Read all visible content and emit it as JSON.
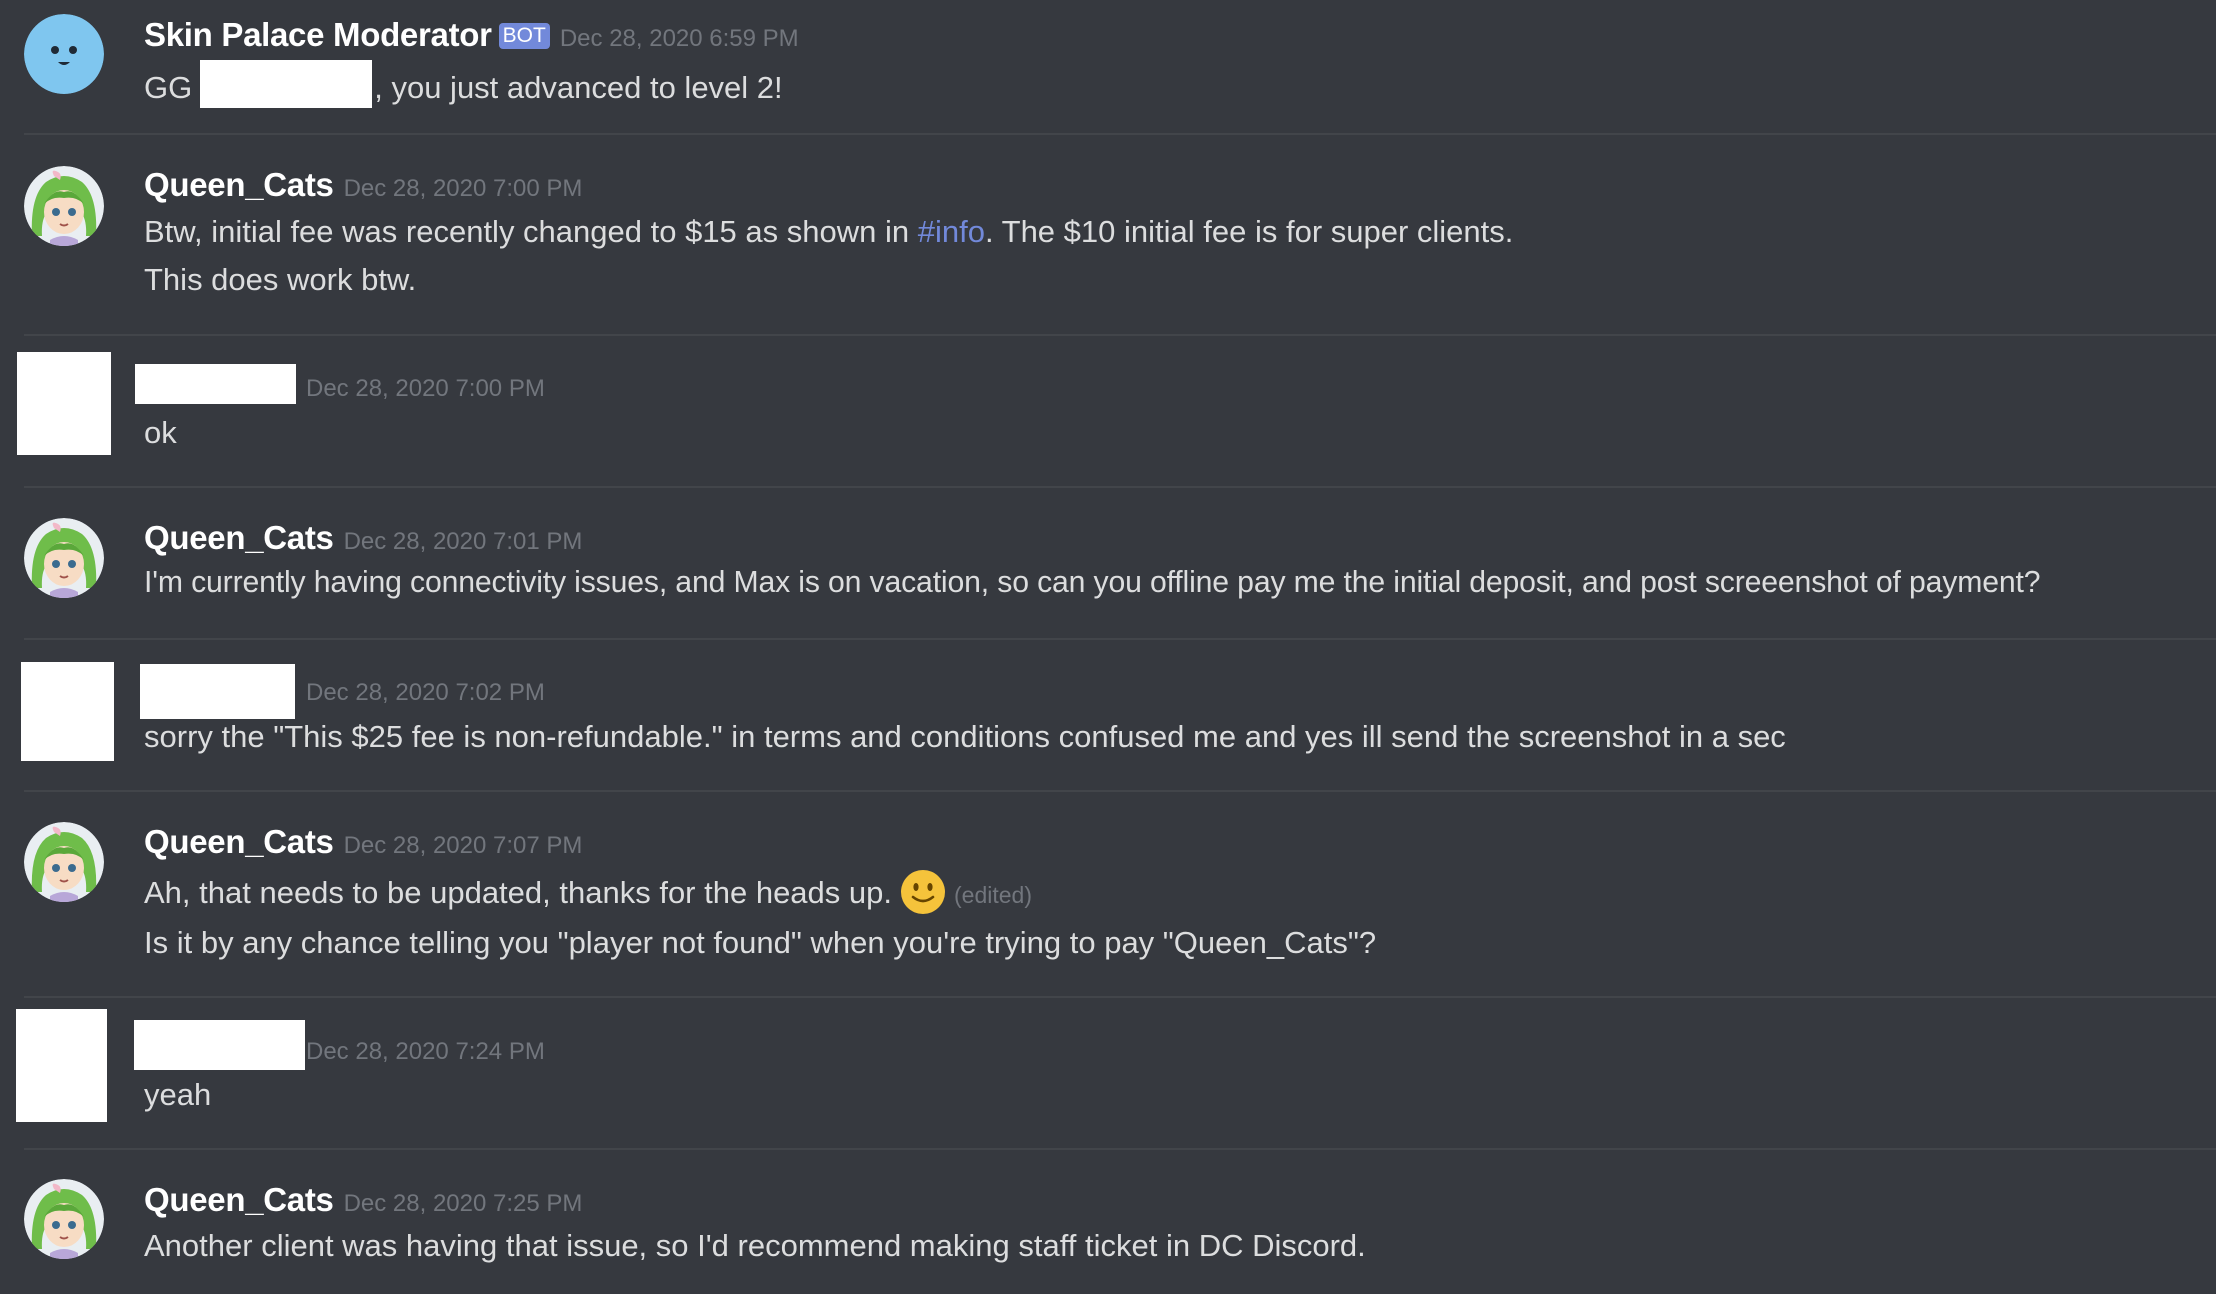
{
  "messages": [
    {
      "username": "Skin Palace Moderator",
      "badge": "BOT",
      "timestamp": "Dec 28, 2020 6:59 PM",
      "line1_prefix": "GG",
      "line1_suffix": ", you just advanced to level 2!"
    },
    {
      "username": "Queen_Cats",
      "timestamp": "Dec 28, 2020 7:00 PM",
      "line1_before": "Btw, initial fee was recently changed to $15 as shown in ",
      "channel_mention": "#info",
      "line1_after": ". The $10 initial fee is for super clients.",
      "line2": "This does work btw."
    },
    {
      "username": "",
      "timestamp": "Dec 28, 2020 7:00 PM",
      "line1": "ok"
    },
    {
      "username": "Queen_Cats",
      "timestamp": "Dec 28, 2020 7:01 PM",
      "line1": "I'm currently having connectivity issues, and Max is on vacation, so can you offline pay me the initial deposit, and post screeenshot of payment?"
    },
    {
      "username": "",
      "timestamp": "Dec 28, 2020 7:02 PM",
      "line1": "sorry the \"This $25 fee is non-refundable.\" in terms and conditions confused me and yes ill send the screenshot in a sec"
    },
    {
      "username": "Queen_Cats",
      "timestamp": "Dec 28, 2020 7:07 PM",
      "line1": "Ah, that needs to be updated, thanks for the heads up.",
      "emoji": "slightly-smiling-face-emoji",
      "edited": "(edited)",
      "line2": "Is it by any chance telling you \"player not found\" when you're trying to pay \"Queen_Cats\"?"
    },
    {
      "username": "",
      "timestamp": "Dec 28, 2020 7:24 PM",
      "line1": "yeah"
    },
    {
      "username": "Queen_Cats",
      "timestamp": "Dec 28, 2020 7:25 PM",
      "line1": "Another client was having that issue, so I'd recommend making staff ticket in DC Discord."
    }
  ],
  "colors": {
    "background": "#36393f",
    "text": "#dcddde",
    "timestamp": "#72767d",
    "mention": "#7289da",
    "bot_badge": "#7289da"
  }
}
